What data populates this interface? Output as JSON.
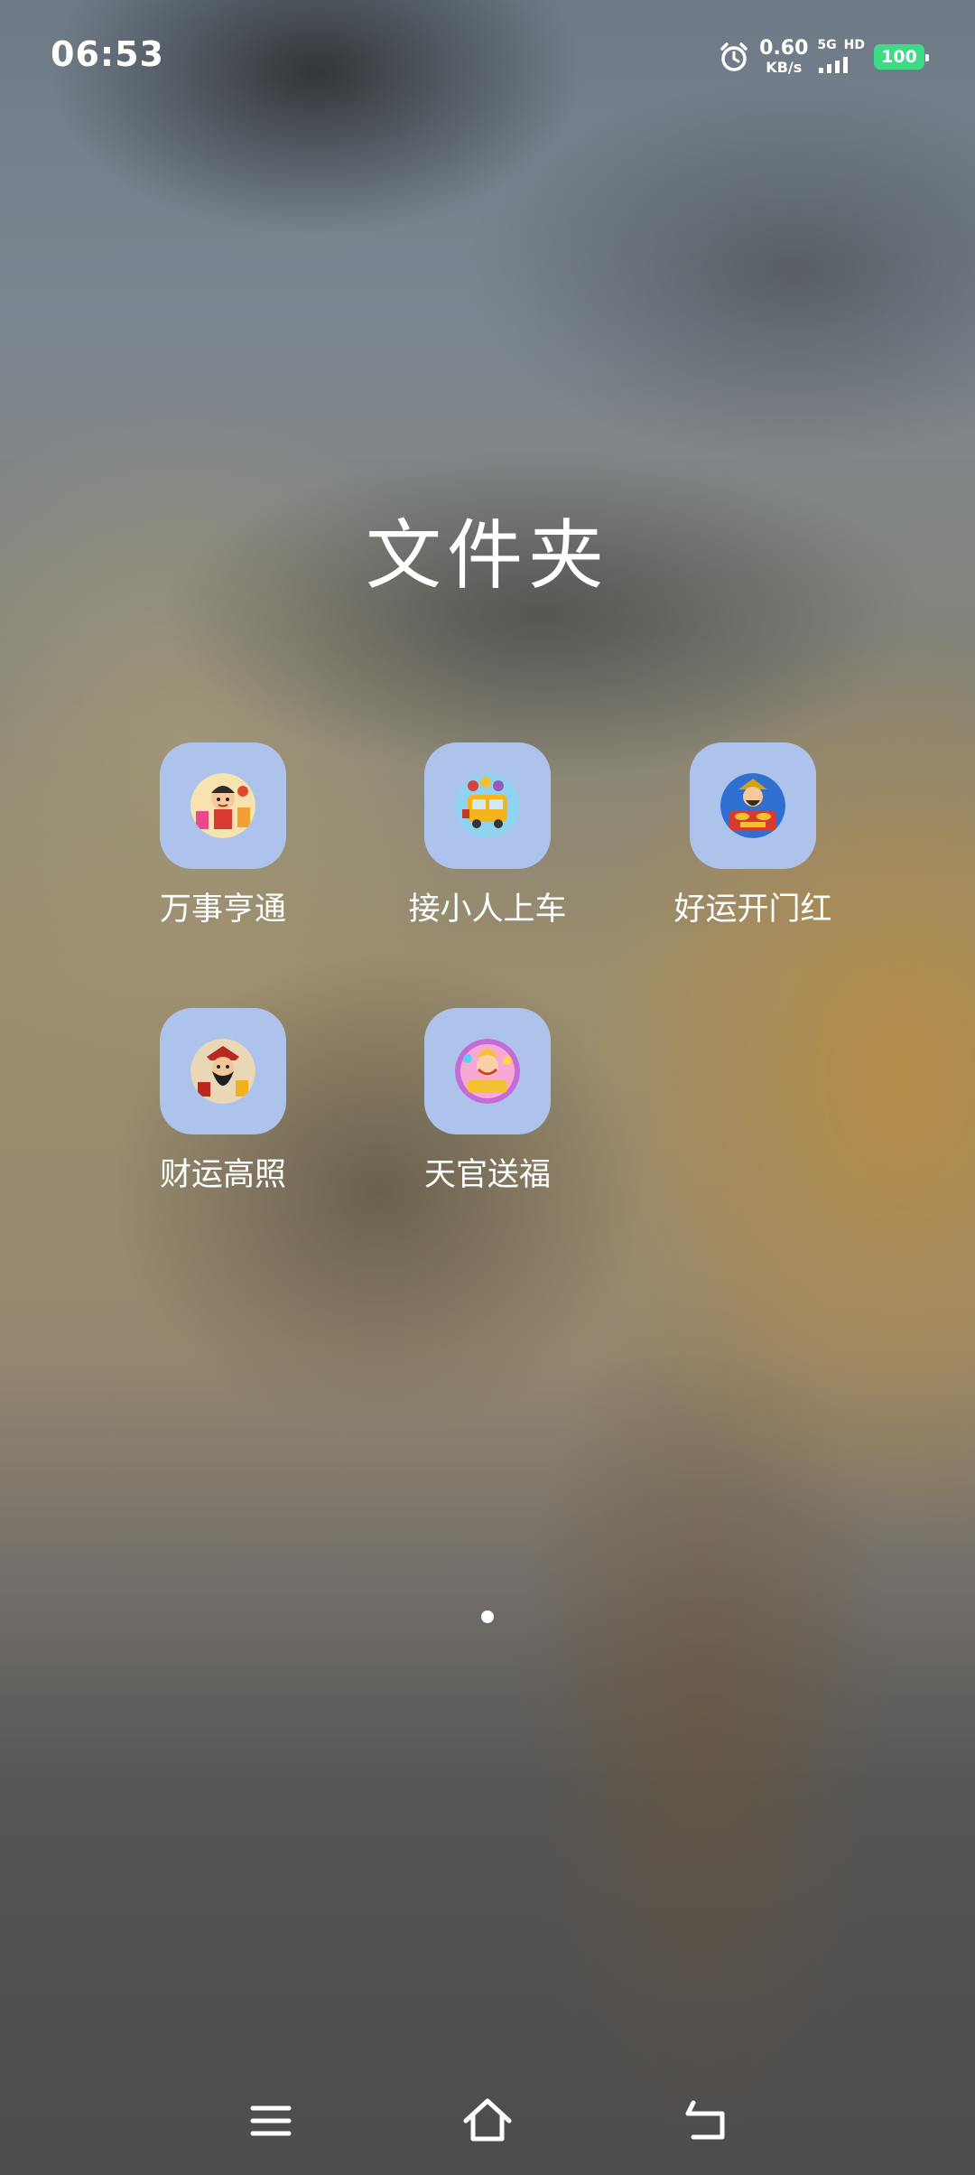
{
  "status_bar": {
    "time": "06:53",
    "alarm_icon": "alarm-clock-icon",
    "net_speed_value": "0.60",
    "net_speed_unit": "KB/s",
    "network_type": "5G",
    "hd_label": "HD",
    "signal_icon": "signal-bars-icon",
    "battery_level": "100",
    "battery_color": "#3ddc84"
  },
  "folder": {
    "title": "文件夹",
    "apps": [
      {
        "label": "万事亨通",
        "icon": "cartoon-fortune-boy-icon"
      },
      {
        "label": "接小人上车",
        "icon": "cartoon-bus-icon"
      },
      {
        "label": "好运开门红",
        "icon": "fortune-god-gold-icon"
      },
      {
        "label": "财运高照",
        "icon": "bearded-fortune-god-icon"
      },
      {
        "label": "天官送福",
        "icon": "heavenly-official-blessing-icon"
      }
    ],
    "tile_color": "#aec3ec"
  },
  "pager": {
    "current_page": 1,
    "total_pages": 1
  },
  "nav_bar": {
    "menu_icon": "menu-icon",
    "home_icon": "home-icon",
    "back_icon": "back-icon"
  }
}
